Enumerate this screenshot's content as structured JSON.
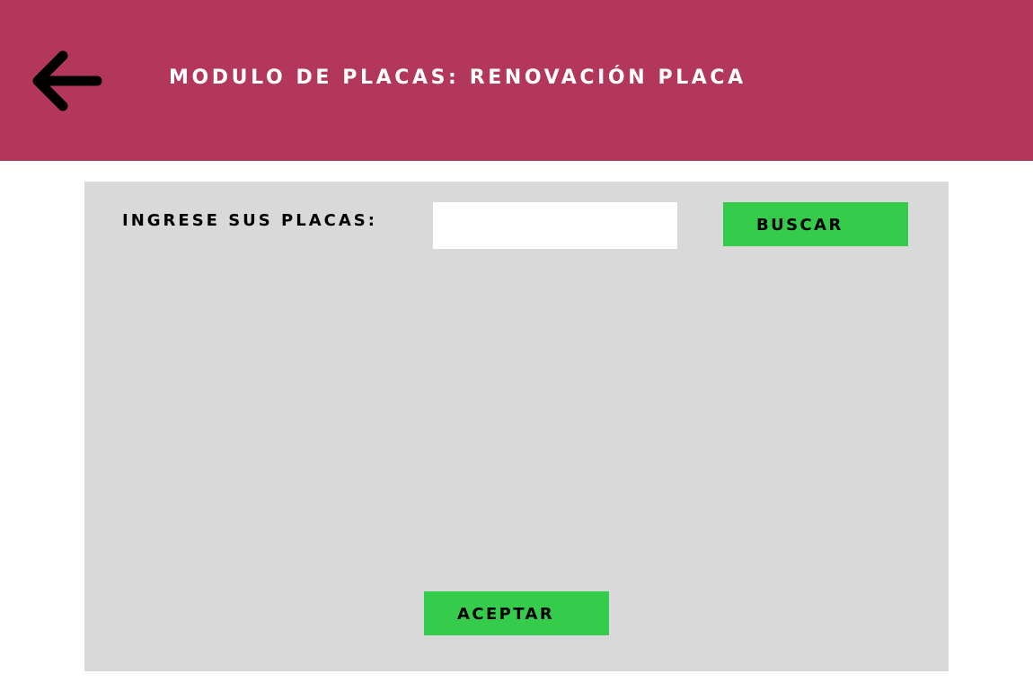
{
  "header": {
    "title": "MODULO DE PLACAS: RENOVACIÓN PLACA",
    "back_icon": "arrow-left-icon",
    "background_color": "#b3375b"
  },
  "form": {
    "plate_label": "INGRESE SUS PLACAS:",
    "plate_input_value": "",
    "plate_input_placeholder": "",
    "search_label": "BUSCAR",
    "accept_label": "ACEPTAR",
    "button_color": "#35cc4b",
    "panel_color": "#d9d9d9"
  }
}
